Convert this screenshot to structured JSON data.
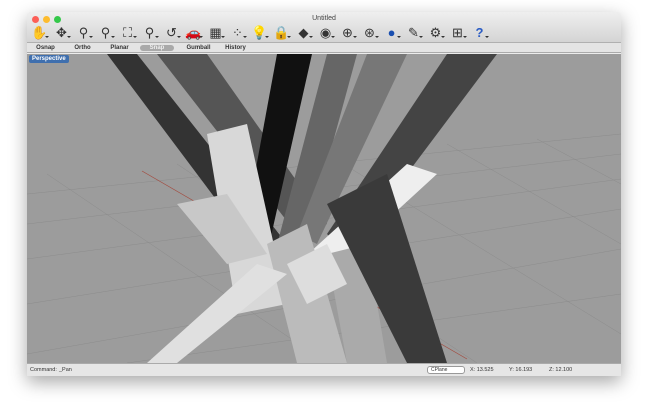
{
  "window": {
    "title": "Untitled"
  },
  "toolbar": {
    "icons": [
      "pan-hand-icon",
      "rotate-view-icon",
      "zoom-icon",
      "zoom-window-icon",
      "zoom-extents-icon",
      "zoom-selected-icon",
      "undo-view-icon",
      "car-render-icon",
      "layer-icon",
      "points-icon",
      "light-bulb-icon",
      "lock-icon",
      "material-icon",
      "color-wheel-icon",
      "sphere-wireframe-icon",
      "sphere-shaded-icon",
      "sphere-render-icon",
      "pen-tool-icon",
      "gear-icon",
      "grid-icon",
      "help-icon"
    ]
  },
  "toggles": [
    {
      "label": "Osnap",
      "on": false
    },
    {
      "label": "Ortho",
      "on": false
    },
    {
      "label": "Planar",
      "on": false
    },
    {
      "label": "Snap",
      "on": true
    },
    {
      "label": "Gumball",
      "on": false
    },
    {
      "label": "History",
      "on": false
    }
  ],
  "viewport": {
    "label": "Perspective"
  },
  "status": {
    "command_label": "Command:",
    "command_value": "_Pan",
    "cplane": "CPlane",
    "x": "X: 13.525",
    "y": "Y: 16.193",
    "z": "Z: 12.100"
  },
  "colors": {
    "close": "#fc5f57",
    "minimize": "#fdbc2e",
    "zoom": "#34c84a",
    "viewport_label": "#3f6fae"
  }
}
